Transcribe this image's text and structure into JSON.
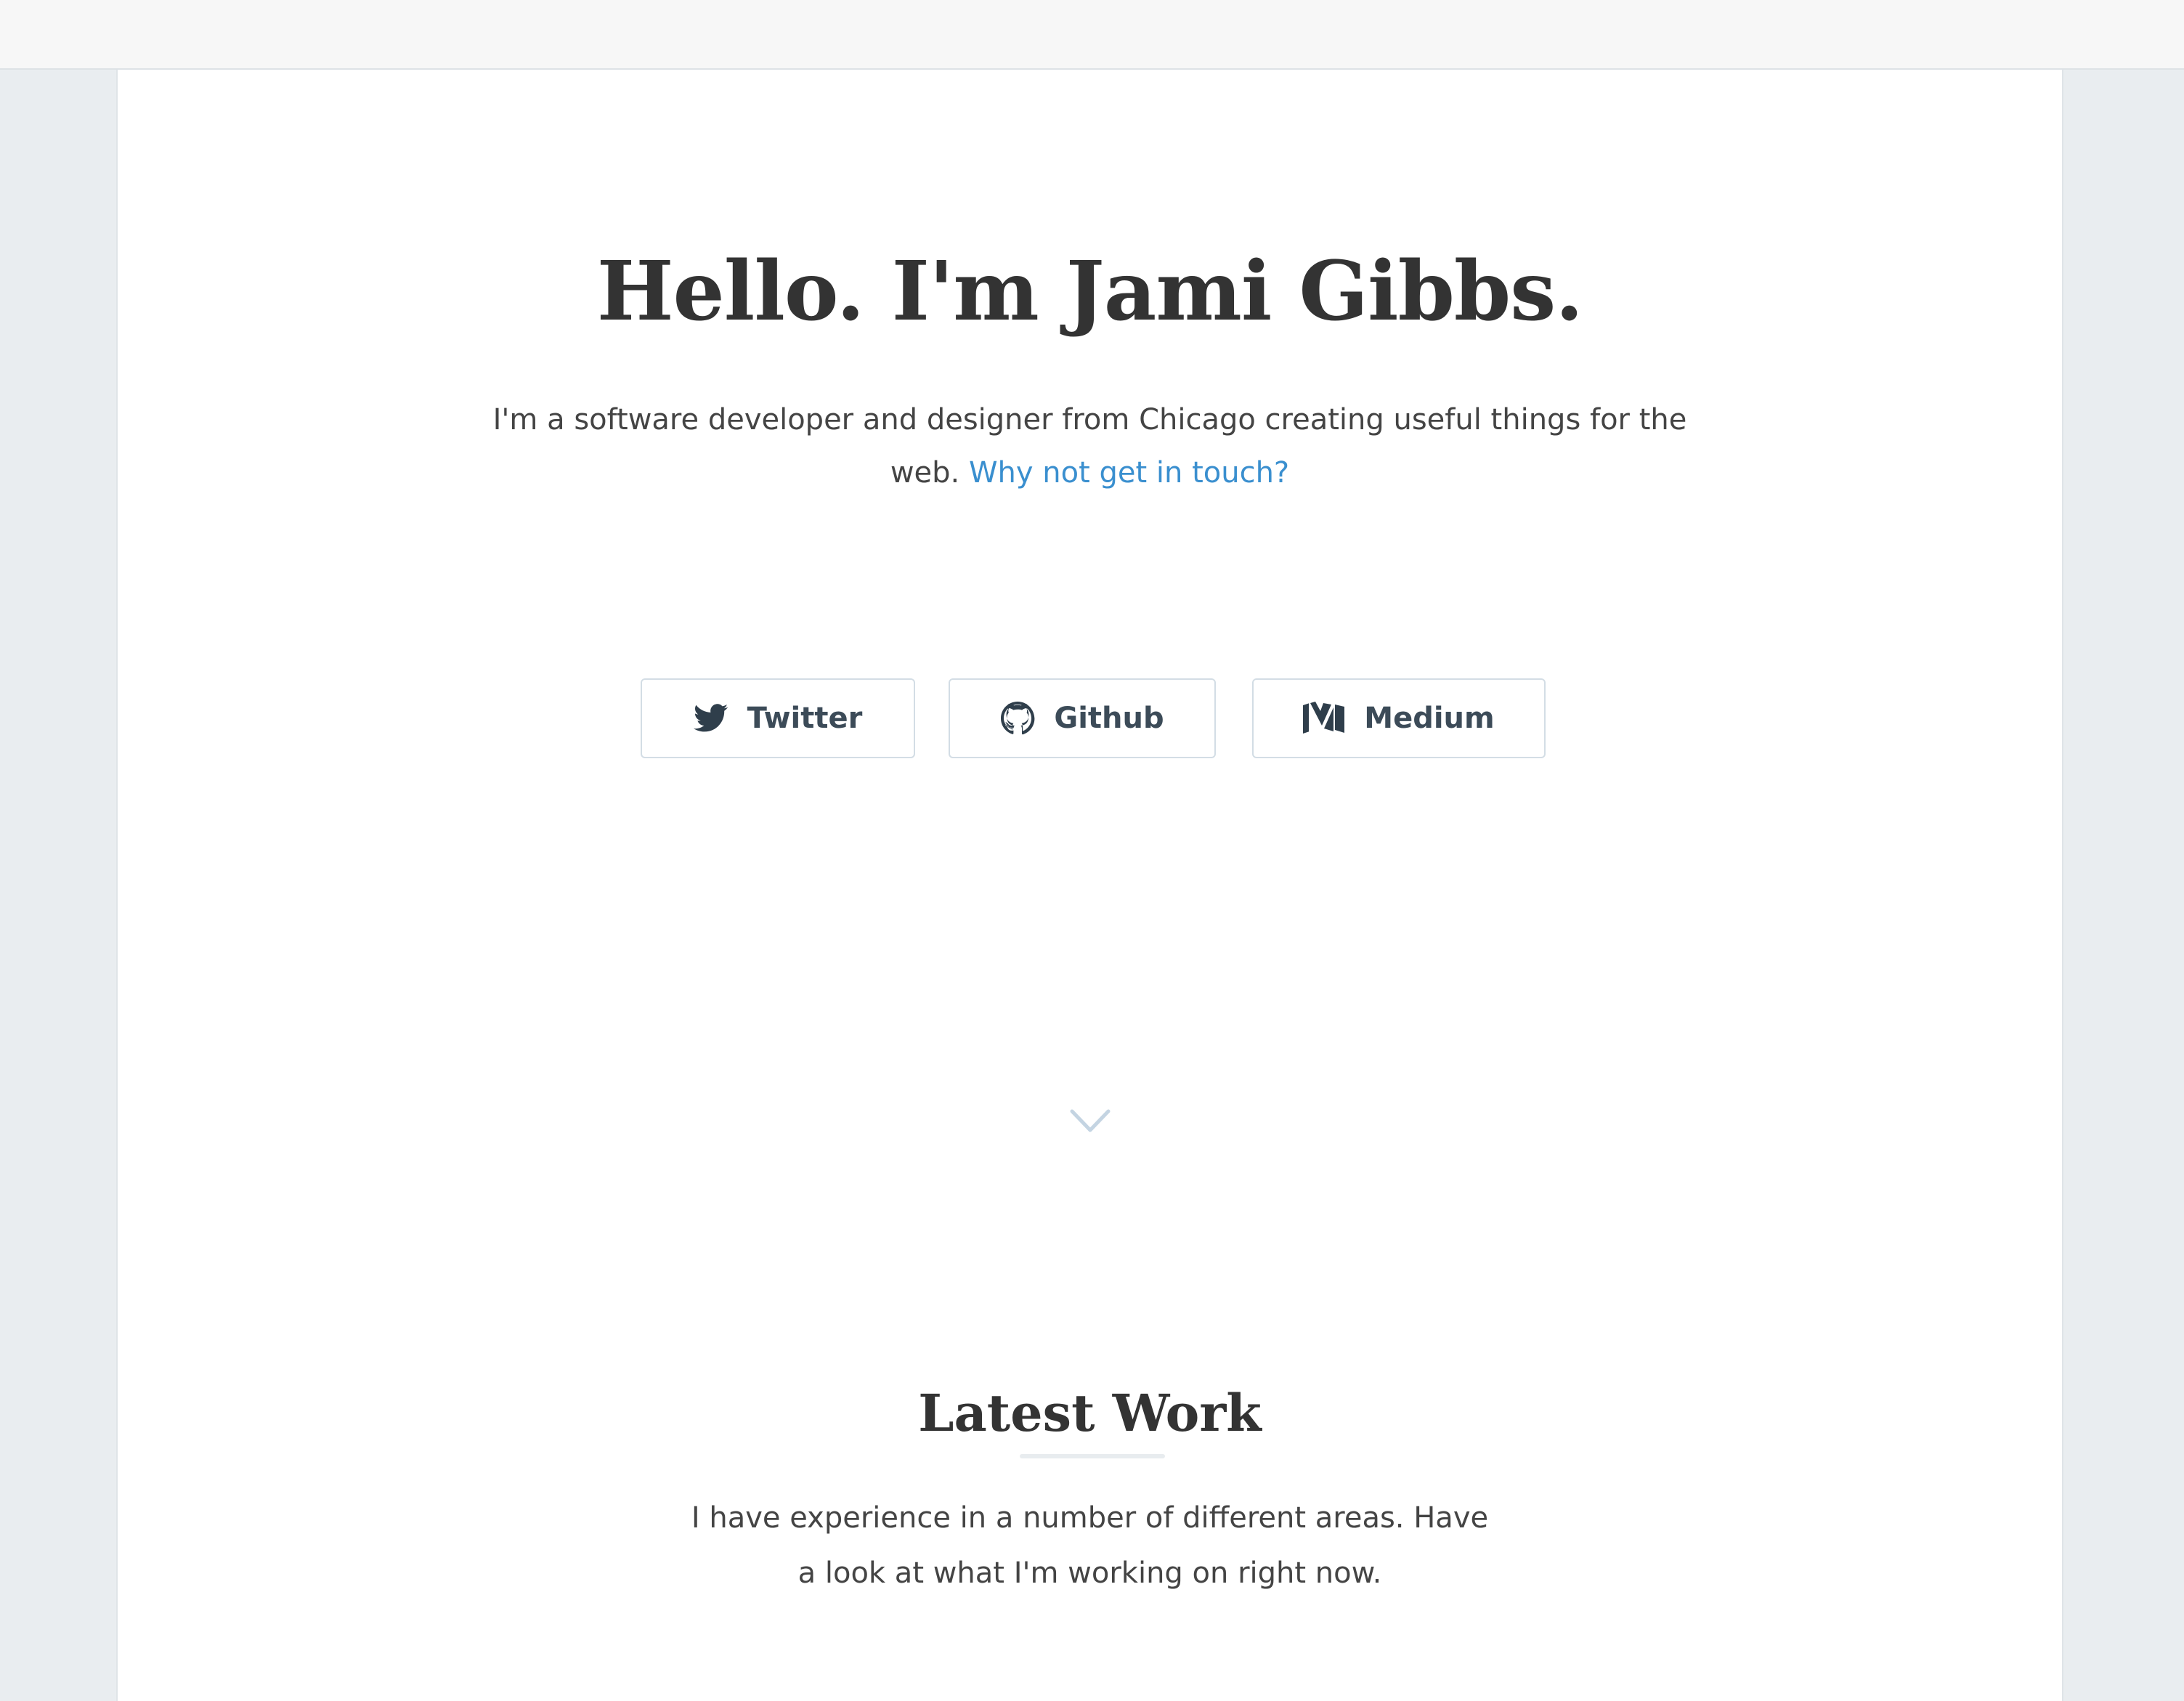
{
  "hero": {
    "title": "Hello. I'm Jami Gibbs.",
    "intro_line1": "I'm a software developer and designer from Chicago creating useful things for the",
    "intro_line2_prefix": "web. ",
    "contact_link": "Why not get in touch?"
  },
  "social": [
    {
      "label": "Twitter",
      "icon": "twitter-icon"
    },
    {
      "label": "Github",
      "icon": "github-icon"
    },
    {
      "label": "Medium",
      "icon": "medium-icon"
    }
  ],
  "scroll_icon": "chevron-down-icon",
  "latest_work": {
    "title": "Latest Work",
    "text_line1": "I have experience in a number of different areas. Have",
    "text_line2": "a look at what I'm working on right now."
  },
  "colors": {
    "link": "#3a8fcf",
    "heading": "#333333",
    "button_text": "#3c4b58",
    "background": "#e9edf0"
  }
}
